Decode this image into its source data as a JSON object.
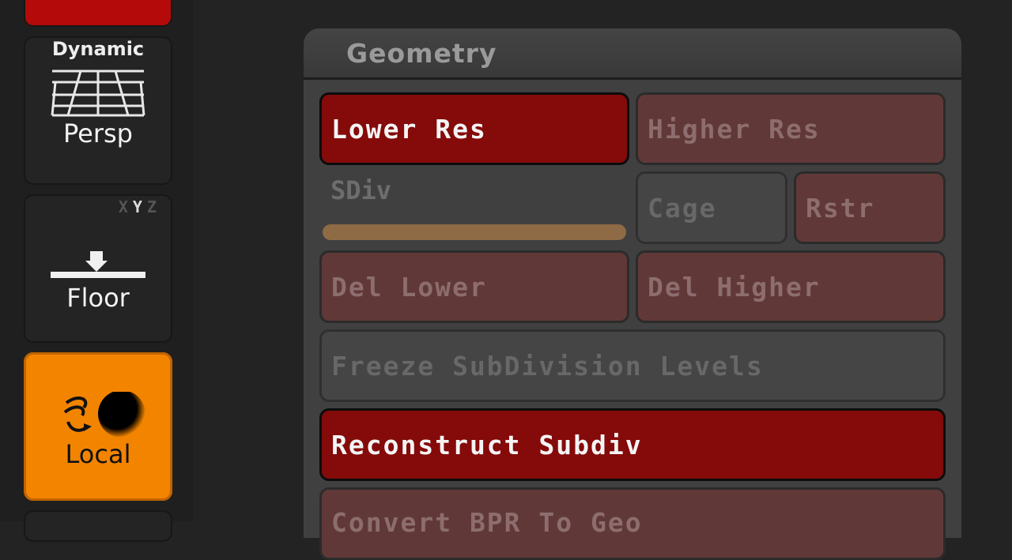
{
  "shelf": {
    "persp": {
      "top_label": "Dynamic",
      "label": "Persp"
    },
    "floor": {
      "axes": [
        "X",
        "Y",
        "Z"
      ],
      "label": "Floor"
    },
    "local": {
      "label": "Local"
    }
  },
  "geometry": {
    "title": "Geometry",
    "lower_res": "Lower Res",
    "higher_res": "Higher Res",
    "sdiv": "SDiv",
    "cage": "Cage",
    "rstr": "Rstr",
    "del_lower": "Del Lower",
    "del_higher": "Del Higher",
    "freeze": "Freeze SubDivision Levels",
    "reconstruct": "Reconstruct Subdiv",
    "convert": "Convert BPR To Geo"
  },
  "colors": {
    "active_red": "#850a0a",
    "dim_red": "#613838",
    "orange_accent": "#f38400",
    "slider": "#8e6a45"
  }
}
